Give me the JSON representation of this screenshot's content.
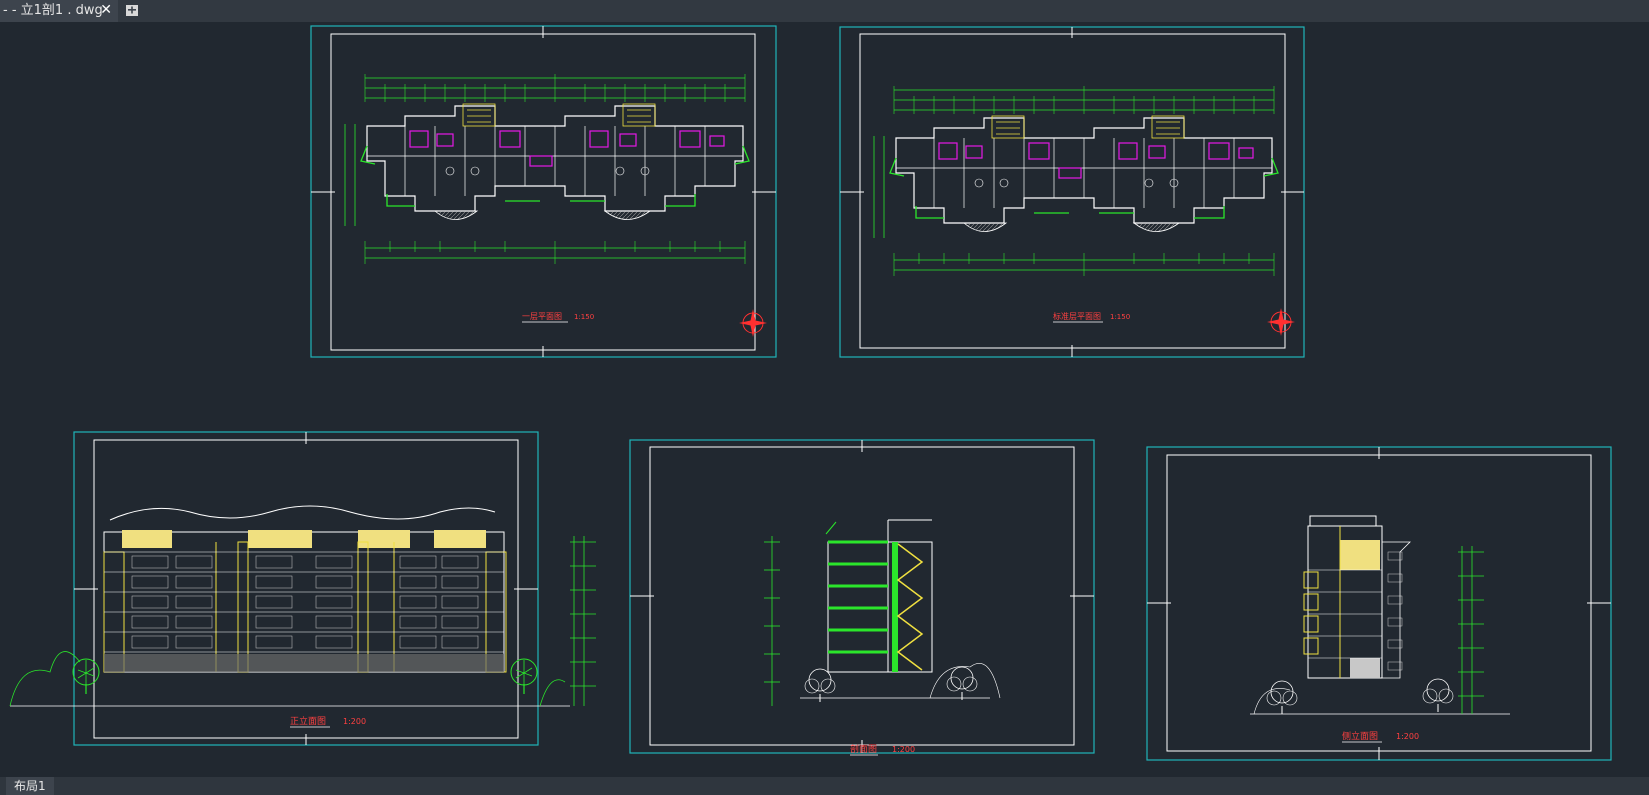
{
  "tabs": {
    "document_label": "- - 立1剖1 . dwg",
    "close_glyph": "✕"
  },
  "layout": {
    "tab_label": "布局1"
  },
  "sheets": {
    "ground_floor_plan": {
      "title": "一层平面图",
      "scale": "1:150"
    },
    "typical_floor_plan": {
      "title": "标准层平面图",
      "scale": "1:150"
    },
    "front_elevation": {
      "title": "正立面图",
      "scale": "1:200"
    },
    "section": {
      "title": "剖面图",
      "scale": "1:200"
    },
    "side_elevation": {
      "title": "侧立面图",
      "scale": "1:200"
    }
  },
  "colors": {
    "background": "#212830",
    "viewport_frame": "#1fb4b8",
    "sheet_frame": "#ffffff",
    "dimension": "#2be62b",
    "accent": "#e619e6",
    "elevation_fill": "#f0e080",
    "title_text": "#ff4040"
  }
}
